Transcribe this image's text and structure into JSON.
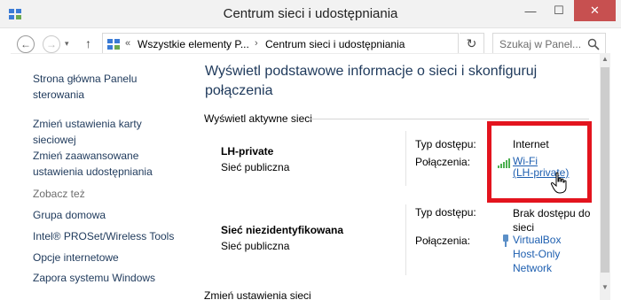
{
  "window": {
    "title": "Centrum sieci i udostępniania",
    "minimize_glyph": "—",
    "maximize_glyph": "☐",
    "close_glyph": "✕"
  },
  "address_bar": {
    "back_glyph": "←",
    "forward_glyph": "→",
    "recent_glyph": "▾",
    "up_glyph": "↑",
    "overflow": "«",
    "breadcrumbs": [
      "Wszystkie elementy P...",
      "Centrum sieci i udostępniania"
    ],
    "separator": "›",
    "dropdown_glyph": "▾",
    "refresh_glyph": "↻",
    "search_placeholder": "Szukaj w Panel..."
  },
  "sidebar": {
    "home_link": [
      "Strona główna Panelu",
      "sterowania"
    ],
    "links": [
      [
        "Zmień ustawienia karty",
        "sieciowej"
      ],
      [
        "Zmień zaawansowane",
        "ustawienia udostępniania"
      ]
    ],
    "see_also_header": "Zobacz też",
    "see_also": [
      "Grupa domowa",
      "Intel® PROSet/Wireless Tools",
      "Opcje internetowe",
      "Zapora systemu Windows"
    ]
  },
  "main": {
    "title_lines": [
      "Wyświetl podstawowe informacje o sieci i skonfiguruj",
      "połączenia"
    ],
    "active_networks_label": "Wyświetl aktywne sieci",
    "networks": [
      {
        "name": "LH-private",
        "category": "Sieć publiczna",
        "access_label": "Typ dostępu:",
        "access_value": "Internet",
        "connections_label": "Połączenia:",
        "connection_lines": [
          "Wi-Fi",
          "(LH-private)"
        ]
      },
      {
        "name": "Sieć niezidentyfikowana",
        "category": "Sieć publiczna",
        "access_label": "Typ dostępu:",
        "access_value_lines": [
          "Brak dostępu do",
          "sieci"
        ],
        "connections_label": "Połączenia:",
        "connection_lines": [
          "VirtualBox",
          "Host-Only",
          "Network"
        ]
      }
    ],
    "bottom_section_label": "Zmień ustawienia sieci"
  },
  "icons": {
    "app": "network-center-icon",
    "address": "network-center-icon",
    "search": "search-icon",
    "wifi": "wifi-signal-icon",
    "adapter": "network-adapter-icon",
    "cursor": "hand-cursor-icon"
  },
  "colors": {
    "link": "#1e395b",
    "hyperlink": "#1e5fb0",
    "close_button": "#c75050",
    "highlight": "#e3141e"
  }
}
